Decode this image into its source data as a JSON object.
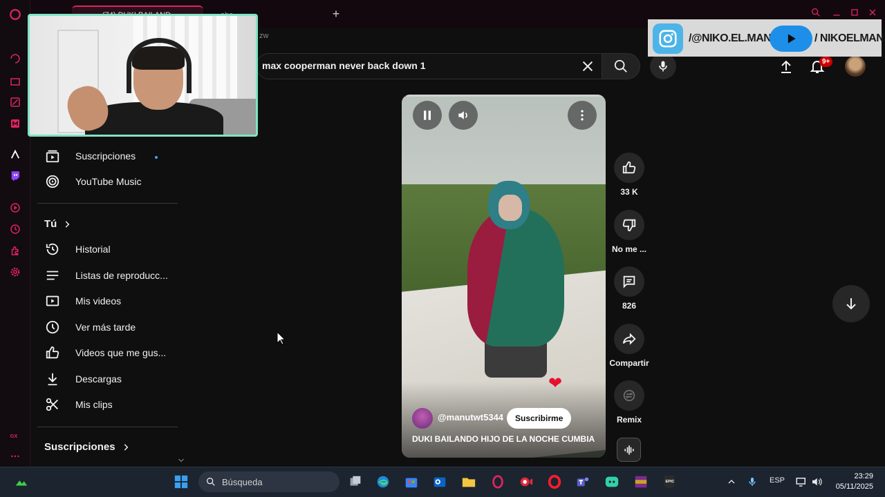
{
  "browser": {
    "tabs": [
      {
        "label": "(74) DUKI BAILAND"
      },
      {
        "label": "abo"
      }
    ],
    "address_fragment": "zw",
    "new_tab_symbol": "+"
  },
  "overlay": {
    "instagram_handle": "/@NIKO.EL.MAN",
    "youtube_handle": "/ NIKOELMAN"
  },
  "youtube": {
    "search": {
      "value": "max cooperman never back down 1"
    },
    "notifications_badge": "9+",
    "guide": {
      "subscriptions_item": "Suscripciones",
      "music_item": "YouTube Music",
      "you_header": "Tú",
      "you_items": [
        {
          "label": "Historial",
          "icon": "history-icon"
        },
        {
          "label": "Listas de reproducc...",
          "icon": "playlists-icon"
        },
        {
          "label": "Mis videos",
          "icon": "my-videos-icon"
        },
        {
          "label": "Ver más tarde",
          "icon": "watch-later-icon"
        },
        {
          "label": "Videos que me gus...",
          "icon": "liked-videos-icon"
        },
        {
          "label": "Descargas",
          "icon": "downloads-icon"
        },
        {
          "label": "Mis clips",
          "icon": "clips-icon"
        }
      ],
      "subscriptions_header": "Suscripciones"
    },
    "short": {
      "channel": "@manutwt5344",
      "subscribe_label": "Suscribirme",
      "title": "DUKI BAILANDO HIJO DE LA NOCHE CUMBIA",
      "progress": 0.02,
      "likes": "33 K",
      "dislike_label": "No me ...",
      "comments": "826",
      "share_label": "Compartir",
      "remix_label": "Remix"
    }
  },
  "taskbar": {
    "search_placeholder": "Búsqueda",
    "language": "ESP",
    "time": "23:29",
    "date": "05/11/2025"
  },
  "colors": {
    "gx_accent": "#e0245e",
    "webcam_border": "#7fe3c6",
    "instagram_blue": "#4db4e8",
    "youtube_pill": "#1e8fe8"
  }
}
